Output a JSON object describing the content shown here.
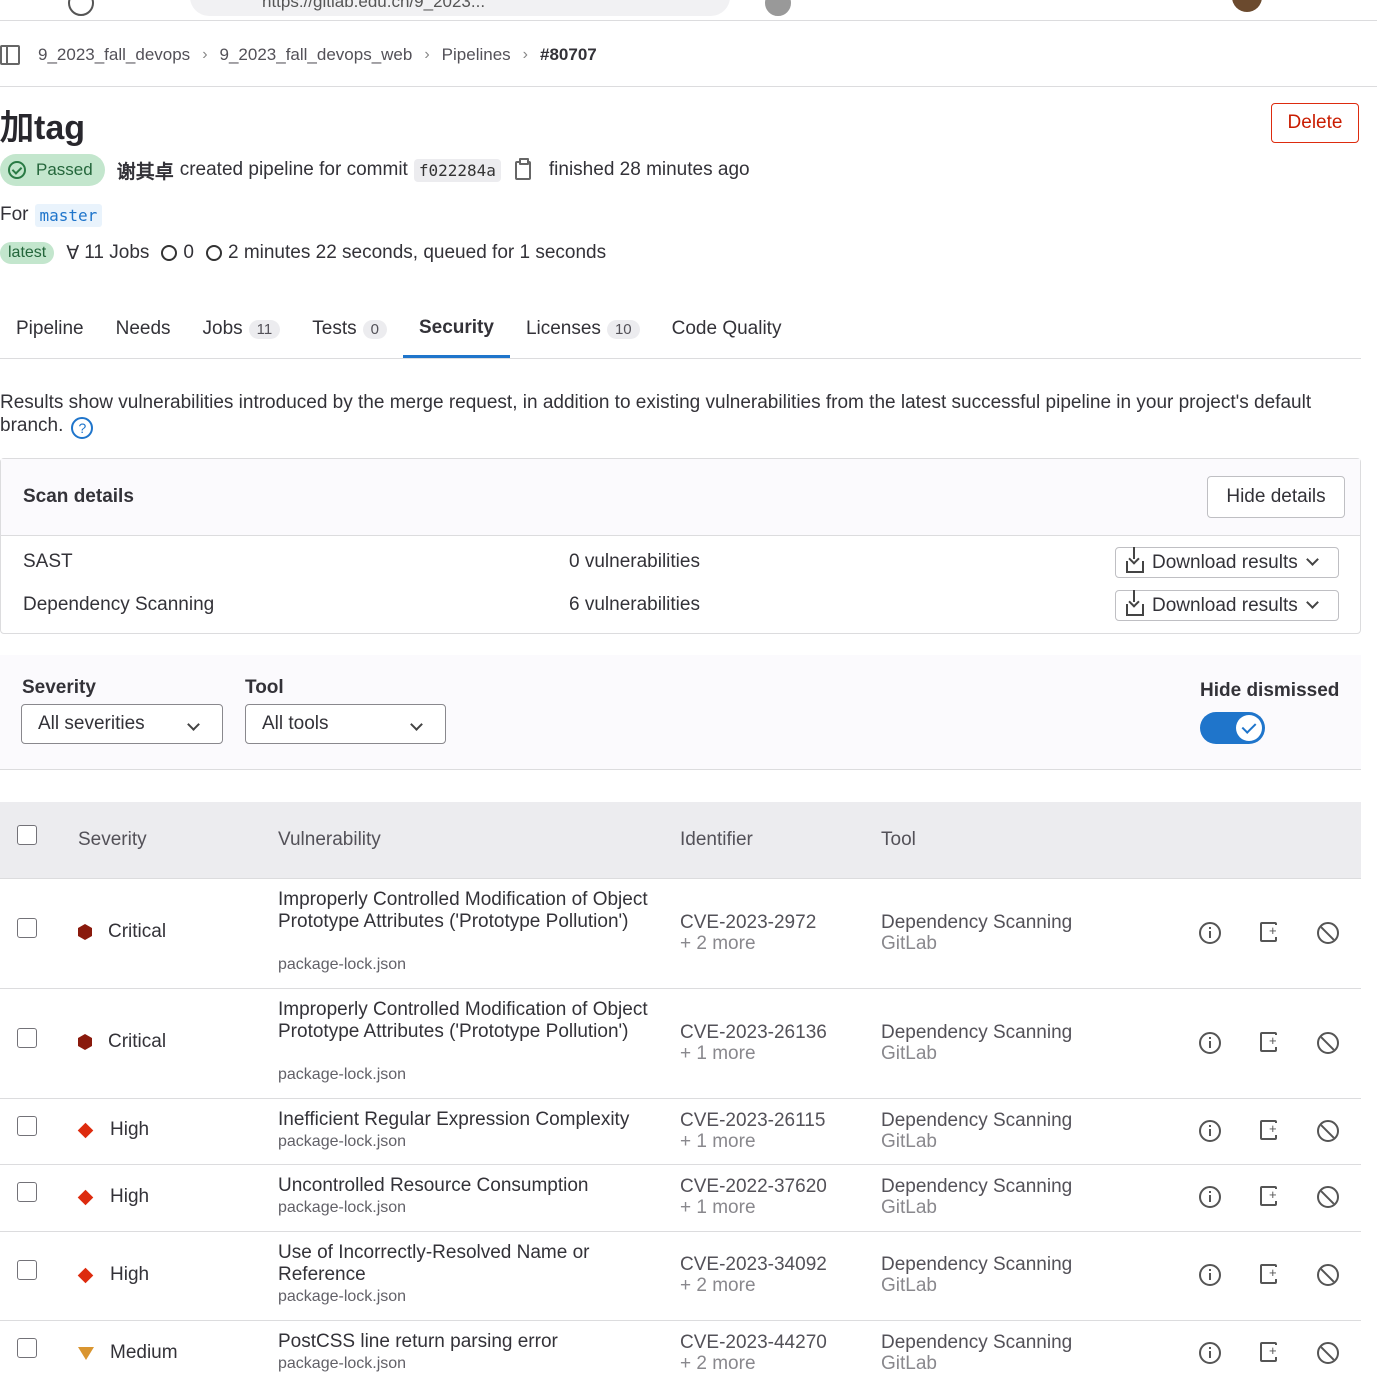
{
  "browser": {
    "url": "https://gitlab.edu.cn/9_2023..."
  },
  "breadcrumb": {
    "items": [
      "9_2023_fall_devops",
      "9_2023_fall_devops_web",
      "Pipelines"
    ],
    "current": "#80707"
  },
  "pipeline": {
    "title": "加tag",
    "delete_label": "Delete",
    "status": "Passed",
    "user": "谢其卓",
    "created_text": "created pipeline for commit",
    "commit": "f022284a",
    "finished": "finished 28 minutes ago",
    "for_label": "For",
    "branch": "master",
    "latest_badge": "latest",
    "jobs": "11 Jobs",
    "warnings": "0",
    "duration": "2 minutes 22 seconds, queued for 1 seconds"
  },
  "tabs": [
    {
      "label": "Pipeline",
      "count": null
    },
    {
      "label": "Needs",
      "count": null
    },
    {
      "label": "Jobs",
      "count": "11"
    },
    {
      "label": "Tests",
      "count": "0"
    },
    {
      "label": "Security",
      "count": null,
      "active": true
    },
    {
      "label": "Licenses",
      "count": "10"
    },
    {
      "label": "Code Quality",
      "count": null
    }
  ],
  "info_text": "Results show vulnerabilities introduced by the merge request, in addition to existing vulnerabilities from the latest successful pipeline in your project's default branch.",
  "scan_details": {
    "title": "Scan details",
    "hide_label": "Hide details",
    "rows": [
      {
        "name": "SAST",
        "count": "0 vulnerabilities",
        "download": "Download results"
      },
      {
        "name": "Dependency Scanning",
        "count": "6 vulnerabilities",
        "download": "Download results"
      }
    ]
  },
  "filters": {
    "severity_label": "Severity",
    "severity_value": "All severities",
    "tool_label": "Tool",
    "tool_value": "All tools",
    "hide_dismissed_label": "Hide dismissed",
    "hide_dismissed": true
  },
  "table": {
    "headers": {
      "severity": "Severity",
      "vulnerability": "Vulnerability",
      "identifier": "Identifier",
      "tool": "Tool"
    },
    "rows": [
      {
        "severity": "Critical",
        "level": "critical",
        "title": "Improperly Controlled Modification of Object Prototype Attributes ('Prototype Pollution')",
        "file": "package-lock.json",
        "identifier": "CVE-2023-2972",
        "more": "+ 2 more",
        "tool": "Dependency Scanning",
        "vendor": "GitLab"
      },
      {
        "severity": "Critical",
        "level": "critical",
        "title": "Improperly Controlled Modification of Object Prototype Attributes ('Prototype Pollution')",
        "file": "package-lock.json",
        "identifier": "CVE-2023-26136",
        "more": "+ 1 more",
        "tool": "Dependency Scanning",
        "vendor": "GitLab"
      },
      {
        "severity": "High",
        "level": "high",
        "title": "Inefficient Regular Expression Complexity",
        "file": "package-lock.json",
        "identifier": "CVE-2023-26115",
        "more": "+ 1 more",
        "tool": "Dependency Scanning",
        "vendor": "GitLab"
      },
      {
        "severity": "High",
        "level": "high",
        "title": "Uncontrolled Resource Consumption",
        "file": "package-lock.json",
        "identifier": "CVE-2022-37620",
        "more": "+ 1 more",
        "tool": "Dependency Scanning",
        "vendor": "GitLab"
      },
      {
        "severity": "High",
        "level": "high",
        "title": "Use of Incorrectly-Resolved Name or Reference",
        "file": "package-lock.json",
        "identifier": "CVE-2023-34092",
        "more": "+ 2 more",
        "tool": "Dependency Scanning",
        "vendor": "GitLab"
      },
      {
        "severity": "Medium",
        "level": "medium",
        "title": "PostCSS line return parsing error",
        "file": "package-lock.json",
        "identifier": "CVE-2023-44270",
        "more": "+ 2 more",
        "tool": "Dependency Scanning",
        "vendor": "GitLab"
      }
    ]
  }
}
